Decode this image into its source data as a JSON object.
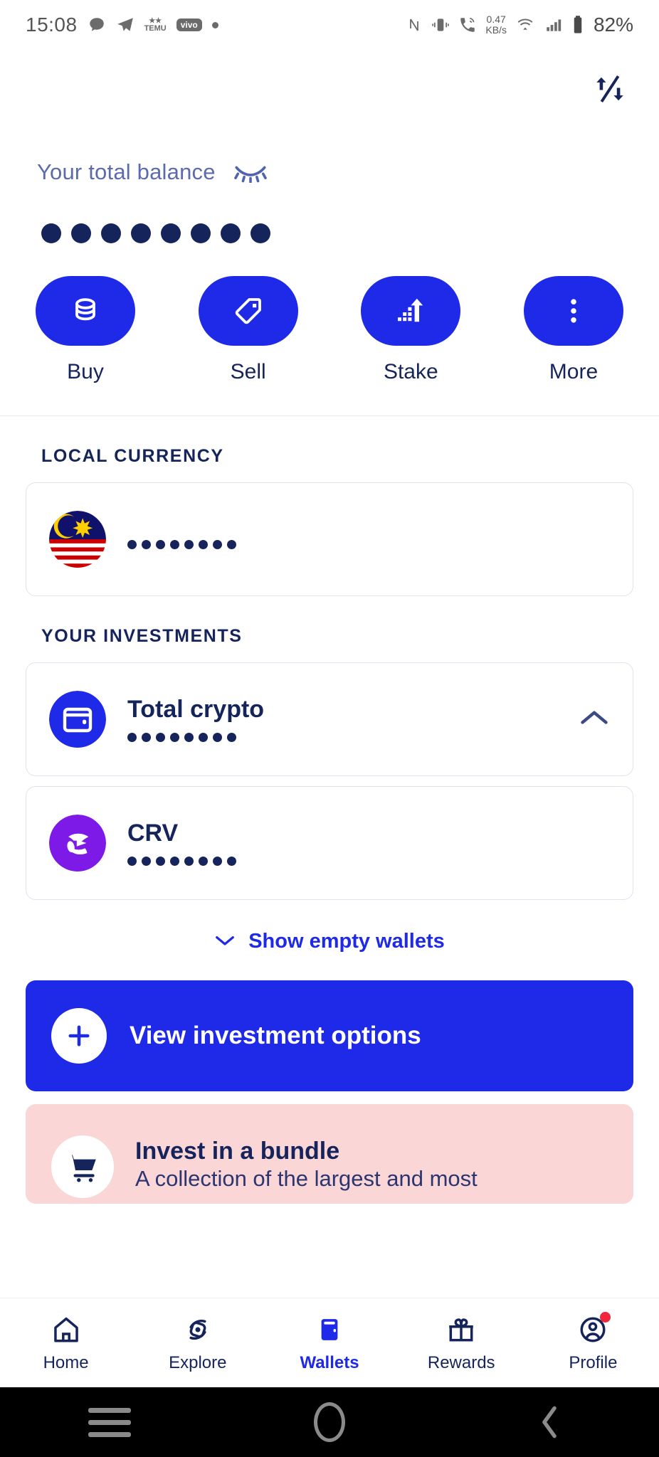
{
  "statusbar": {
    "time": "15:08",
    "temu_label": "TEMU",
    "vivo_label": "vivo",
    "netspeed_value": "0.47",
    "netspeed_unit": "KB/s",
    "battery": "82%",
    "icons": [
      "chat-icon",
      "telegram-icon",
      "temu-icon",
      "vivo-icon",
      "dot-icon",
      "nfc-icon",
      "vibrate-icon",
      "call-icon",
      "wifi-icon",
      "signal-icon",
      "battery-icon"
    ]
  },
  "topbar": {
    "swap_icon": "swap-vertical-icon"
  },
  "balance": {
    "label": "Your total balance",
    "eye_icon": "eye-closed-icon",
    "hidden_dots": 8
  },
  "actions": [
    {
      "label": "Buy",
      "icon": "coins-stack-icon"
    },
    {
      "label": "Sell",
      "icon": "price-tag-icon"
    },
    {
      "label": "Stake",
      "icon": "growth-arrow-icon"
    },
    {
      "label": "More",
      "icon": "more-vertical-icon"
    }
  ],
  "local_currency": {
    "title": "LOCAL CURRENCY",
    "items": [
      {
        "name": "",
        "icon": "malaysia-flag-icon",
        "hidden_dots": 8
      }
    ]
  },
  "investments": {
    "title": "YOUR INVESTMENTS",
    "items": [
      {
        "name": "Total crypto",
        "icon": "wallet-icon",
        "hidden_dots": 8,
        "chevron": "chevron-up-icon",
        "has_chevron": true
      },
      {
        "name": "CRV",
        "icon": "crv-icon",
        "hidden_dots": 8,
        "has_chevron": false
      }
    ],
    "show_empty_label": "Show empty wallets",
    "show_empty_icon": "chevron-down-icon"
  },
  "cta": {
    "label": "View investment options",
    "icon": "plus-icon"
  },
  "bundle": {
    "title": "Invest in a bundle",
    "subtitle": "A collection of the largest and most",
    "icon": "shopping-cart-icon"
  },
  "bottom_nav": [
    {
      "label": "Home",
      "icon": "home-icon",
      "active": false,
      "badge": false
    },
    {
      "label": "Explore",
      "icon": "explore-icon",
      "active": false,
      "badge": false
    },
    {
      "label": "Wallets",
      "icon": "wallet-filled-icon",
      "active": true,
      "badge": false
    },
    {
      "label": "Rewards",
      "icon": "gift-icon",
      "active": false,
      "badge": false
    },
    {
      "label": "Profile",
      "icon": "profile-icon",
      "active": false,
      "badge": true
    }
  ],
  "system_nav": [
    {
      "icon": "recents-icon"
    },
    {
      "icon": "home-circle-icon"
    },
    {
      "icon": "back-icon"
    }
  ],
  "colors": {
    "primary_blue": "#1f2ae8",
    "navy": "#16245c",
    "muted_blue": "#5c6bae",
    "pink_card": "#fad6d6",
    "crv_purple": "#7d1ae8",
    "badge_red": "#f0263c"
  }
}
